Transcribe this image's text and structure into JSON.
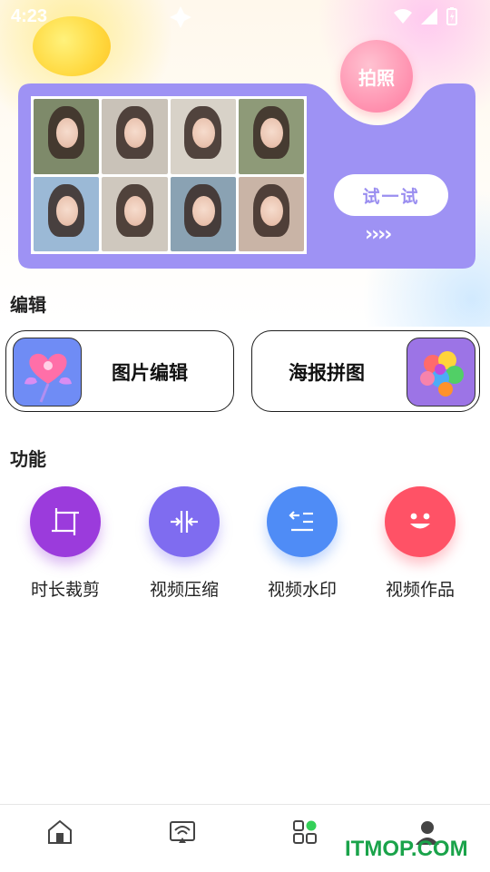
{
  "status_bar": {
    "time": "4:23"
  },
  "banner": {
    "badge_label": "拍照",
    "try_label": "试一试",
    "arrows": "››››",
    "photo_colors": [
      "#7e8a6a",
      "#c9c2b8",
      "#d8d2c8",
      "#8e9a78",
      "#9bb9d6",
      "#cfc8be",
      "#8aa2b3",
      "#c9b4a6"
    ],
    "banner_color": "#9e92f4"
  },
  "edit_section": {
    "title": "编辑",
    "cards": [
      {
        "label": "图片编辑",
        "icon": "heart-balloon-icon",
        "icon_bg": "#6f8cf5"
      },
      {
        "label": "海报拼图",
        "icon": "color-cubes-icon",
        "icon_bg": "#9c74e6"
      }
    ]
  },
  "function_section": {
    "title": "功能",
    "items": [
      {
        "label": "时长裁剪",
        "icon": "crop-icon",
        "color": "#9b3bdc"
      },
      {
        "label": "视频压缩",
        "icon": "compress-icon",
        "color": "#7f6cf0"
      },
      {
        "label": "视频水印",
        "icon": "watermark-icon",
        "color": "#4f8cf6"
      },
      {
        "label": "视频作品",
        "icon": "smile-icon",
        "color": "#ff5266"
      }
    ]
  },
  "tab_bar": {
    "tabs": [
      {
        "icon": "home-icon"
      },
      {
        "icon": "screen-cast-icon"
      },
      {
        "icon": "apps-grid-icon"
      },
      {
        "icon": "profile-icon"
      }
    ]
  },
  "watermark": "ITMOP.COM"
}
